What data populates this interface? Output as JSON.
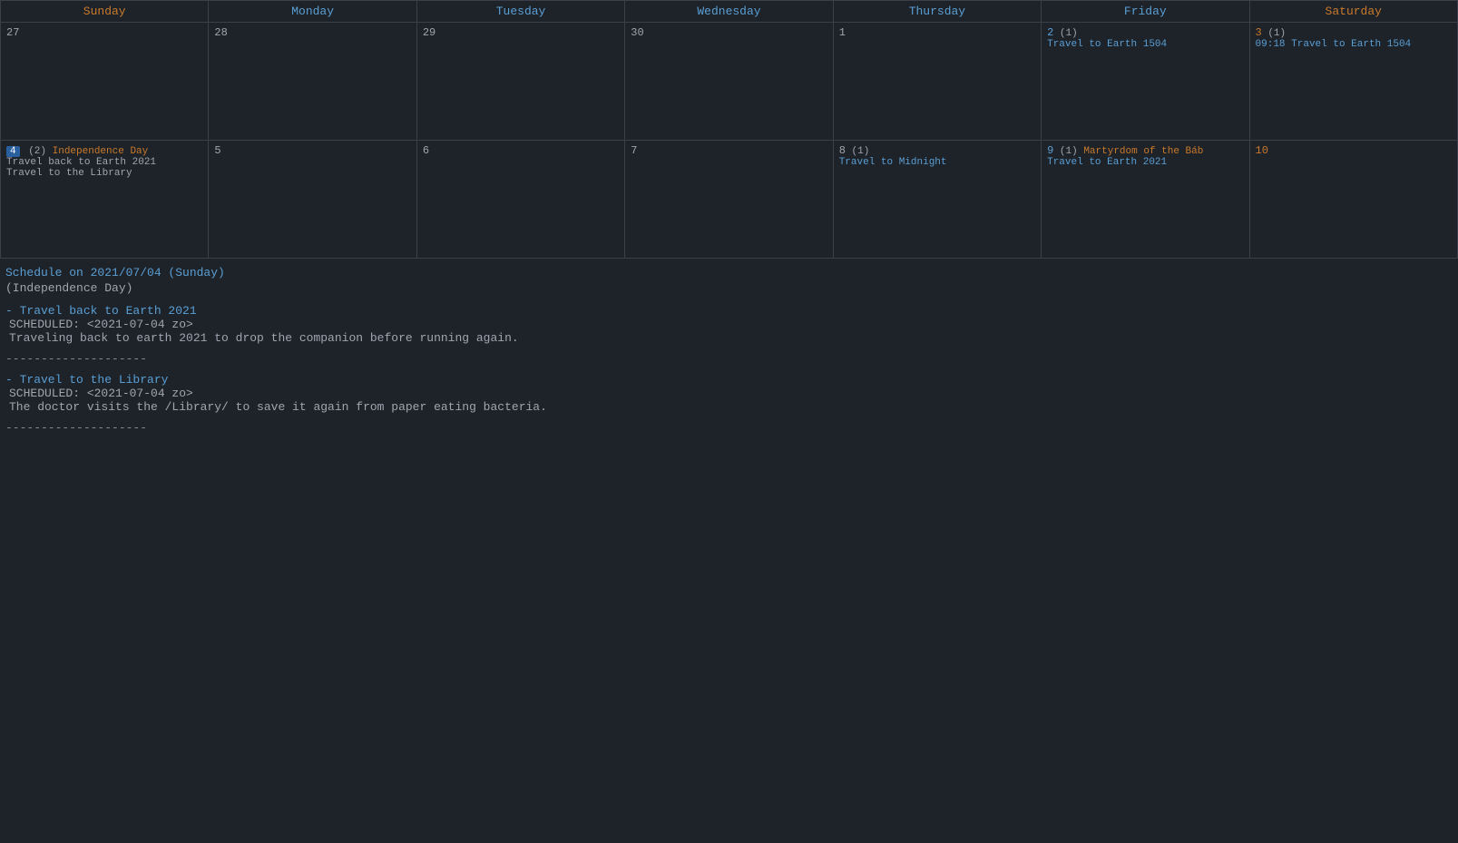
{
  "calendar": {
    "headers": [
      {
        "label": "Sunday",
        "class": "sun-header"
      },
      {
        "label": "Monday",
        "class": "mon-header"
      },
      {
        "label": "Tuesday",
        "class": "tue-header"
      },
      {
        "label": "Wednesday",
        "class": "wed-header"
      },
      {
        "label": "Thursday",
        "class": "thu-header"
      },
      {
        "label": "Friday",
        "class": "fri-header"
      },
      {
        "label": "Saturday",
        "class": "sat-header"
      }
    ],
    "weeks": [
      {
        "days": [
          {
            "num": "27",
            "numClass": "",
            "events": []
          },
          {
            "num": "28",
            "numClass": "",
            "events": []
          },
          {
            "num": "29",
            "numClass": "",
            "events": []
          },
          {
            "num": "30",
            "numClass": "",
            "events": []
          },
          {
            "num": "1",
            "numClass": "",
            "events": []
          },
          {
            "num": "2",
            "numClass": "day-number-blue",
            "badge": "(1)",
            "events": [
              {
                "text": "Travel to Earth 1504",
                "class": "event-travel"
              }
            ]
          },
          {
            "num": "3",
            "numClass": "day-number-red",
            "badge": "(1)",
            "events": [
              {
                "text": "09:18 Travel to Earth 1504",
                "class": "event-travel"
              }
            ]
          }
        ]
      },
      {
        "days": [
          {
            "num": "4",
            "numClass": "day-number-highlighted",
            "badge": "(2)",
            "holiday": "Independence Day",
            "events": [
              {
                "text": "Travel back to Earth 2021",
                "class": "event-text"
              },
              {
                "text": "Travel to the Library",
                "class": "event-text"
              }
            ]
          },
          {
            "num": "5",
            "numClass": "",
            "events": []
          },
          {
            "num": "6",
            "numClass": "",
            "events": []
          },
          {
            "num": "7",
            "numClass": "",
            "events": []
          },
          {
            "num": "8",
            "numClass": "",
            "badge": "(1)",
            "events": [
              {
                "text": "Travel to Midnight",
                "class": "event-travel"
              }
            ]
          },
          {
            "num": "9",
            "numClass": "day-number-blue",
            "badge": "(1)",
            "holiday": "Martyrdom of the Báb",
            "events": [
              {
                "text": "Travel to Earth 2021",
                "class": "event-travel"
              }
            ]
          },
          {
            "num": "10",
            "numClass": "day-number-red",
            "events": []
          }
        ]
      }
    ]
  },
  "schedule": {
    "title": "Schedule on 2021/07/04 (Sunday)",
    "subtitle": "(Independence Day)",
    "items": [
      {
        "title": "- Travel back to Earth 2021",
        "scheduled": "SCHEDULED: <2021-07-04 zo>",
        "description": "Traveling back to earth 2021 to drop the companion before running again."
      },
      {
        "title": "- Travel to the Library",
        "scheduled": "SCHEDULED: <2021-07-04 zo>",
        "description": "The doctor visits the /Library/ to save it again from paper eating bacteria."
      }
    ],
    "divider": "--------------------"
  }
}
